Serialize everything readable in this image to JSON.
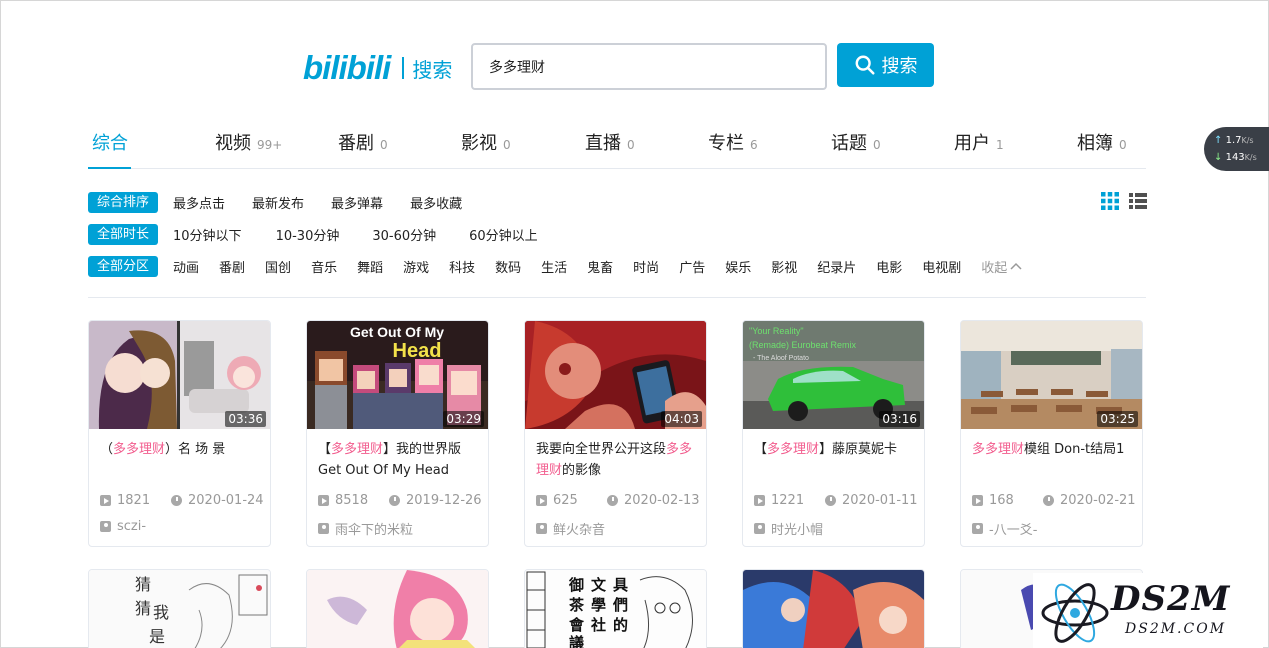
{
  "header": {
    "logo_text": "bilibili",
    "logo_sub": "搜索",
    "search_value": "多多理财",
    "search_button": "搜索"
  },
  "tabs": [
    {
      "label": "综合",
      "count": ""
    },
    {
      "label": "视频",
      "count": "99+"
    },
    {
      "label": "番剧",
      "count": "0"
    },
    {
      "label": "影视",
      "count": "0"
    },
    {
      "label": "直播",
      "count": "0"
    },
    {
      "label": "专栏",
      "count": "6"
    },
    {
      "label": "话题",
      "count": "0"
    },
    {
      "label": "用户",
      "count": "1"
    },
    {
      "label": "相簿",
      "count": "0"
    }
  ],
  "filters": {
    "order_active": "综合排序",
    "order_options": [
      "最多点击",
      "最新发布",
      "最多弹幕",
      "最多收藏"
    ],
    "duration_active": "全部时长",
    "duration_options": [
      "10分钟以下",
      "10-30分钟",
      "30-60分钟",
      "60分钟以上"
    ],
    "zone_active": "全部分区",
    "zones": [
      "动画",
      "番剧",
      "国创",
      "音乐",
      "舞蹈",
      "游戏",
      "科技",
      "数码",
      "生活",
      "鬼畜",
      "时尚",
      "广告",
      "娱乐",
      "影视",
      "纪录片",
      "电影",
      "电视剧"
    ],
    "collapse_label": "收起"
  },
  "videos": [
    {
      "title_pre": "（",
      "title_hl": "多多理财",
      "title_post": "）名 场 景",
      "duration": "03:36",
      "plays": "1821",
      "date": "2020-01-24",
      "author": "sczi-"
    },
    {
      "title_pre": "【",
      "title_hl": "多多理财",
      "title_post": "】我的世界版Get Out Of My Head",
      "duration": "03:29",
      "plays": "8518",
      "date": "2019-12-26",
      "author": "雨伞下的米粒"
    },
    {
      "title_pre": "我要向全世界公开这段",
      "title_hl": "多多理财",
      "title_post": "的影像",
      "duration": "04:03",
      "plays": "625",
      "date": "2020-02-13",
      "author": "鲜火杂音"
    },
    {
      "title_pre": "【",
      "title_hl": "多多理财",
      "title_post": "】藤原莫妮卡",
      "duration": "03:16",
      "plays": "1221",
      "date": "2020-01-11",
      "author": "时光小帽"
    },
    {
      "title_pre": "",
      "title_hl": "多多理财",
      "title_post": "模组 Don-t结局1",
      "duration": "03:25",
      "plays": "168",
      "date": "2020-02-21",
      "author": "-八一爻-"
    }
  ],
  "thumb_text": {
    "mc_line1": "Get Out Of My",
    "mc_line2": "Head",
    "car_line1": "\"Your Reality\"",
    "car_line2": "(Remade) Eurobeat Remix",
    "car_line3": "- The Aloof Potato",
    "manga_guess": "猜猜我是",
    "manga_cols": "具們文學社的御茶會議"
  },
  "net_widget": {
    "up": "1.7",
    "up_unit": "K/s",
    "down": "143",
    "down_unit": "K/s"
  },
  "watermark": {
    "title": "DS2M",
    "sub": "DS2M.COM"
  },
  "colors": {
    "accent": "#00a1d6",
    "highlight": "#f25d8e"
  }
}
